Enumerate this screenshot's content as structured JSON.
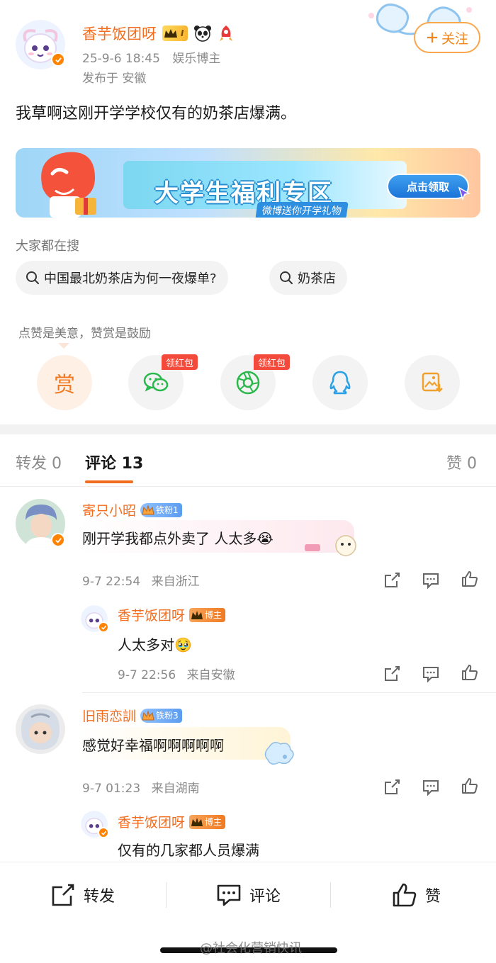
{
  "post": {
    "author": "香芋饭团呀",
    "level": "I",
    "time": "25-9-6 18:45",
    "tag": "娱乐博主",
    "location": "发布于 安徽",
    "follow_label": "关注",
    "text": "我草啊这刚开学学校仅有的奶茶店爆满。"
  },
  "banner": {
    "title": "大学生福利专区",
    "subtitle": "微博送你开学礼物",
    "button": "点击领取"
  },
  "search": {
    "title": "大家都在搜",
    "chips": [
      "中国最北奶茶店为何一夜爆单?",
      "奶茶店"
    ]
  },
  "reward": {
    "note": "点赞是美意，赞赏是鼓励",
    "reward_label": "赏",
    "red_tag": "领红包",
    "share_targets": [
      "reward",
      "wechat",
      "moments",
      "qq",
      "save-image"
    ]
  },
  "tabs": {
    "repost": "转发 0",
    "comment": "评论 13",
    "like": "赞 0"
  },
  "comments": [
    {
      "name": "寄只小昭",
      "fan_badge": "铁粉1",
      "text": "刚开学我都点外卖了 人太多😭",
      "time": "9-7 22:54",
      "from": "来自浙江",
      "reply": {
        "name": "香芋饭团呀",
        "badge": "博主",
        "text": "人太多对🥹",
        "time": "9-7 22:56",
        "from": "来自安徽"
      }
    },
    {
      "name": "旧雨恋訓",
      "fan_badge": "铁粉3",
      "text": "感觉好幸福啊啊啊啊啊",
      "time": "9-7 01:23",
      "from": "来自湖南",
      "reply": {
        "name": "香芋饭团呀",
        "badge": "博主",
        "text": "仅有的几家都人员爆满"
      }
    }
  ],
  "bottom_bar": {
    "repost": "转发",
    "comment": "评论",
    "like": "赞"
  },
  "watermark": "@社会化营销快讯",
  "colors": {
    "accent": "#f36d1f",
    "follow_border": "#f9a64c",
    "red_tag": "#f44a3b",
    "wechat_green": "#2ab84c",
    "qq_blue": "#2ba1e8"
  }
}
